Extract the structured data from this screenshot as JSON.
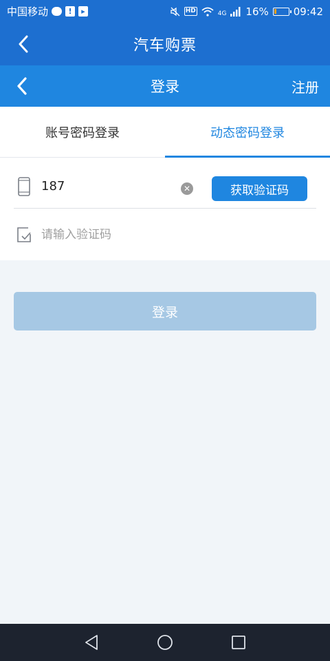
{
  "status_bar": {
    "carrier": "中国移动",
    "network": "4G",
    "hd": "HD",
    "battery_pct": "16%",
    "battery_level": 0.16,
    "time": "09:42"
  },
  "app_header": {
    "title": "汽车购票",
    "back_icon": "chevron-left-icon"
  },
  "page_header": {
    "title": "登录",
    "register_label": "注册",
    "back_icon": "chevron-left-icon"
  },
  "tabs": [
    {
      "label": "账号密码登录",
      "active": false
    },
    {
      "label": "动态密码登录",
      "active": true
    }
  ],
  "form": {
    "phone_value": "187",
    "get_code_label": "获取验证码",
    "code_placeholder": "请输入验证码"
  },
  "login_button": {
    "label": "登录"
  },
  "colors": {
    "header_bg": "#1d6fd0",
    "accent": "#1f86e0",
    "login_disabled": "#a6c8e4",
    "nav_bg": "#1d232f"
  }
}
